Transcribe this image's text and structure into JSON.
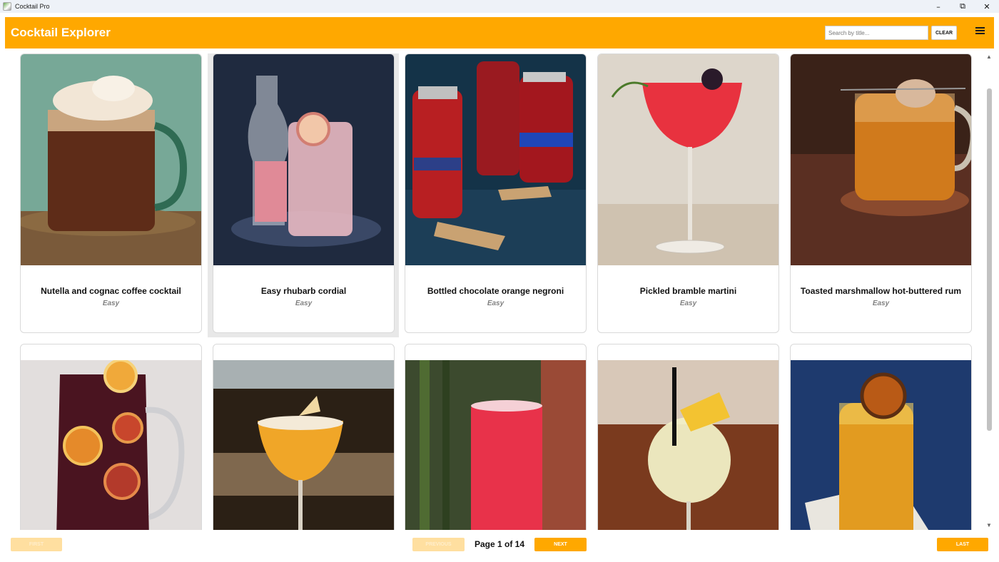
{
  "window": {
    "title": "Cocktail Pro"
  },
  "header": {
    "title": "Cocktail Explorer",
    "search_placeholder": "Search by title...",
    "clear_label": "CLEAR",
    "accent_color": "#ffa800"
  },
  "cards": [
    {
      "title": "Nutella and cognac coffee cocktail",
      "difficulty": "Easy"
    },
    {
      "title": "Easy rhubarb cordial",
      "difficulty": "Easy"
    },
    {
      "title": "Bottled chocolate orange negroni",
      "difficulty": "Easy"
    },
    {
      "title": "Pickled bramble martini",
      "difficulty": "Easy"
    },
    {
      "title": "Toasted marshmallow hot-buttered rum",
      "difficulty": "Easy"
    },
    {
      "title": "",
      "difficulty": ""
    },
    {
      "title": "",
      "difficulty": ""
    },
    {
      "title": "",
      "difficulty": ""
    },
    {
      "title": "",
      "difficulty": ""
    },
    {
      "title": "",
      "difficulty": ""
    }
  ],
  "pagination": {
    "first_label": "FIRST",
    "previous_label": "PREVIOUS",
    "page_text": "Page 1 of 14",
    "next_label": "NEXT",
    "last_label": "LAST"
  }
}
